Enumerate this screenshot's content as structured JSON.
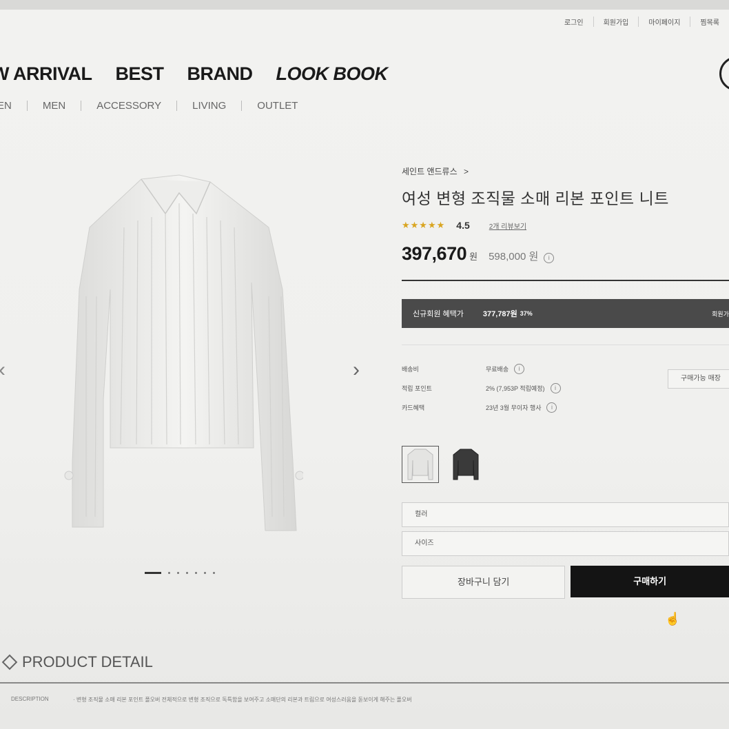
{
  "util_nav": [
    "로그인",
    "회원가입",
    "마이페이지",
    "찜목록"
  ],
  "main_nav": {
    "new_arrival": "W ARRIVAL",
    "best": "BEST",
    "brand": "BRAND",
    "lookbook": "LOOK BOOK"
  },
  "sub_nav": [
    "EN",
    "MEN",
    "ACCESSORY",
    "LIVING",
    "OUTLET"
  ],
  "product": {
    "brand": "세인트 앤드류스",
    "brand_arrow": ">",
    "title": "여성 변형 조직물 소매 리본 포인트 니트",
    "rating_stars": "★★★★★",
    "rating": "4.5",
    "review_link": "2개 리뷰보기",
    "price": "397,670",
    "currency": "원",
    "original_price": "598,000 원",
    "info_glyph": "i"
  },
  "member_benefit": {
    "label": "신규회원 혜택가",
    "price": "377,787원",
    "percent": "37%",
    "right": "회원가"
  },
  "specs": [
    {
      "key": "배송비",
      "value": "무료배송"
    },
    {
      "key": "적립 포인트",
      "value": "2% (7,953P 적립예정)"
    },
    {
      "key": "카드혜택",
      "value": "23년 3월 무이자 행사"
    }
  ],
  "spec_button": "구매가능 매장",
  "options": {
    "color_placeholder": "컬러",
    "size_placeholder": "사이즈"
  },
  "buttons": {
    "cart": "장바구니 담기",
    "buy": "구매하기"
  },
  "carousel": {
    "prev": "‹",
    "next": "›"
  },
  "detail": {
    "heading": "PRODUCT DETAIL",
    "desc_label": "DESCRIPTION",
    "desc_text": "· 변형 조직물 소매 리본 포인트 폴오버 전체적으로 변형 조직으로 독특함을 보여주고 소매단의 리본과 트림으로 여성스러움을 돋보이게 해주는 폴오버"
  },
  "colors": {
    "member_bar": "#4a4a4a",
    "buy_button": "#141414",
    "star": "#d9a520"
  }
}
